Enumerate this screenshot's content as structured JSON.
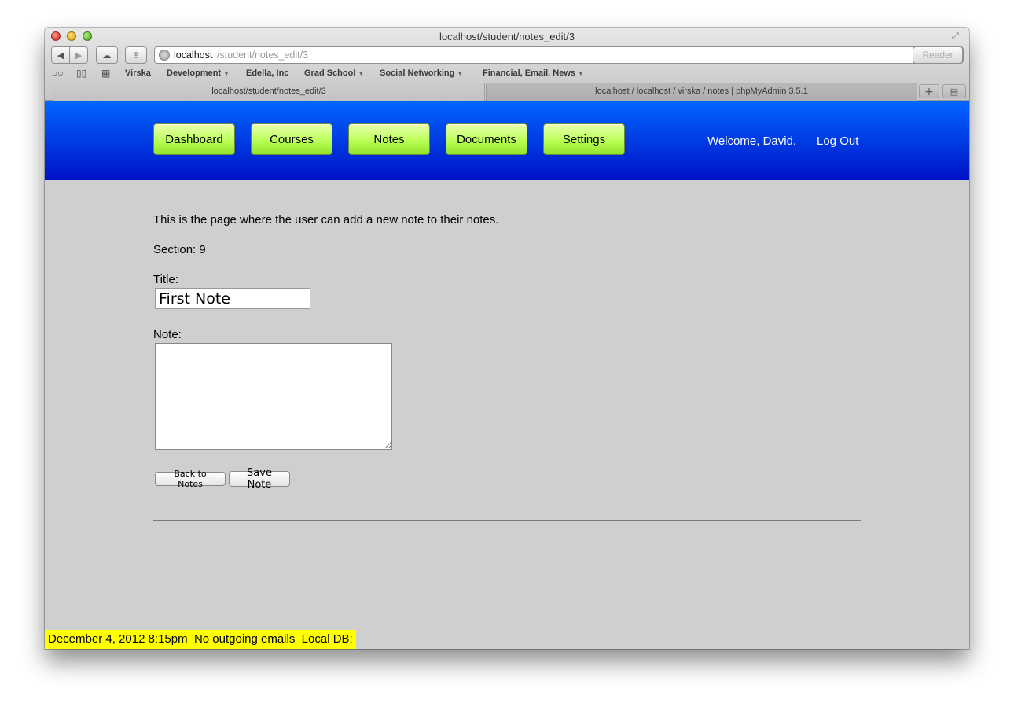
{
  "window": {
    "title": "localhost/student/notes_edit/3"
  },
  "toolbar": {
    "back": "◀",
    "forward": "▶",
    "icloud": "☁",
    "share": "⇪",
    "url_host": "localhost",
    "url_path": "/student/notes_edit/3",
    "reload": "↻",
    "reader": "Reader"
  },
  "bookmarks": {
    "reading_list": "👓",
    "bookmarks_book": "📖",
    "top_sites": "▦",
    "items": [
      {
        "label": "Virska",
        "menu": false
      },
      {
        "label": "Development",
        "menu": true
      },
      {
        "label": "Edella, Inc",
        "menu": false
      },
      {
        "label": "Grad School",
        "menu": true
      },
      {
        "label": "Social Networking",
        "menu": true
      },
      {
        "label": "Financial, Email, News",
        "menu": true
      }
    ],
    "arrow": "▼"
  },
  "tabs": [
    {
      "label": "localhost/student/notes_edit/3",
      "active": true
    },
    {
      "label": "localhost / localhost / virska / notes | phpMyAdmin 3.5.1",
      "active": false
    }
  ],
  "tab_controls": {
    "new_tab": "+",
    "tab_view": "▤"
  },
  "nav": {
    "items": [
      "Dashboard",
      "Courses",
      "Notes",
      "Documents",
      "Settings"
    ],
    "welcome": "Welcome, David.",
    "logout": "Log Out"
  },
  "main": {
    "intro": "This is the page where the user can add a new note to their notes.",
    "section": "Section: 9",
    "title_label": "Title:",
    "title_value": "First Note",
    "note_label": "Note:",
    "note_value": "",
    "back_button": "Back to Notes",
    "save_button": "Save Note"
  },
  "status_bar": "December 4, 2012 8:15pm  No outgoing emails  Local DB;",
  "colors": {
    "header_top": "#0066ff",
    "header_bottom": "#0011c4",
    "nav_button": "#baff58",
    "status_bg": "#ffff00",
    "page_bg": "#cfcfcf"
  }
}
